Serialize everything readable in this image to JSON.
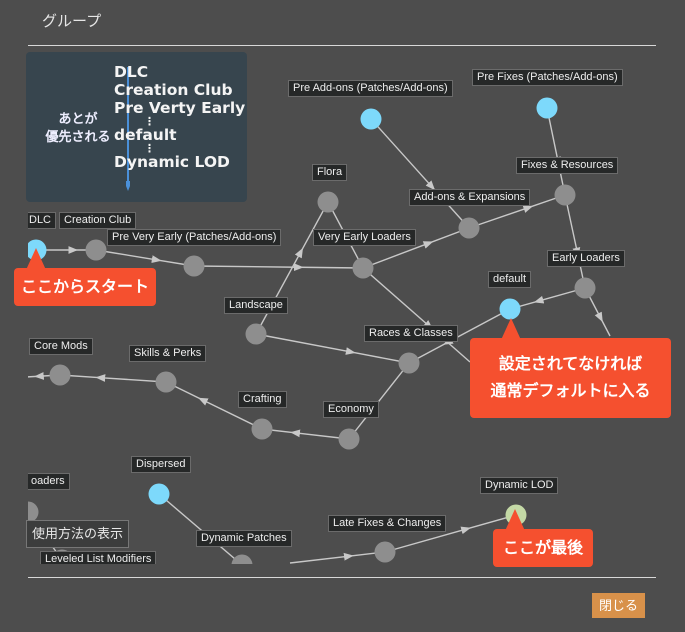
{
  "dialog": {
    "title": "グループ",
    "close_label": "閉じる",
    "usage_label": "使用方法の表示"
  },
  "legend": {
    "side_text": [
      "あとが",
      "優先される"
    ],
    "items": [
      "DLC",
      "Creation Club",
      "Pre Verty Early",
      "⋮",
      "default",
      "⋮",
      "Dynamic LOD"
    ],
    "arrow_color": "#4a90d9"
  },
  "colors": {
    "background": "#4d4d4d",
    "node_default": "#8e8e8e",
    "node_root": "#7dd9fb",
    "node_last": "#c4d9a6",
    "edge": "#c8c8c8",
    "callout": "#f5502f",
    "close_button": "#d8914a"
  },
  "nodes": [
    {
      "id": "dlc",
      "label": "DLC",
      "kind": "root"
    },
    {
      "id": "creation_club",
      "label": "Creation Club",
      "kind": "normal"
    },
    {
      "id": "pre_very_early",
      "label": "Pre Very Early (Patches/Add-ons)",
      "kind": "normal"
    },
    {
      "id": "flora",
      "label": "Flora",
      "kind": "normal"
    },
    {
      "id": "very_early",
      "label": "Very Early Loaders",
      "kind": "normal"
    },
    {
      "id": "landscape",
      "label": "Landscape",
      "kind": "normal"
    },
    {
      "id": "pre_addons",
      "label": "Pre Add-ons (Patches/Add-ons)",
      "kind": "root"
    },
    {
      "id": "addons",
      "label": "Add-ons & Expansions",
      "kind": "normal"
    },
    {
      "id": "pre_fixes",
      "label": "Pre Fixes (Patches/Add-ons)",
      "kind": "root"
    },
    {
      "id": "fixes",
      "label": "Fixes & Resources",
      "kind": "normal"
    },
    {
      "id": "early_loaders",
      "label": "Early Loaders",
      "kind": "normal"
    },
    {
      "id": "default",
      "label": "default",
      "kind": "root"
    },
    {
      "id": "races",
      "label": "Races & Classes",
      "kind": "normal"
    },
    {
      "id": "economy",
      "label": "Economy",
      "kind": "normal"
    },
    {
      "id": "crafting",
      "label": "Crafting",
      "kind": "normal"
    },
    {
      "id": "skills",
      "label": "Skills & Perks",
      "kind": "normal"
    },
    {
      "id": "core_mods",
      "label": "Core Mods",
      "kind": "normal"
    },
    {
      "id": "loaders",
      "label": "oaders",
      "kind": "normal"
    },
    {
      "id": "dispersed",
      "label": "Dispersed",
      "kind": "root"
    },
    {
      "id": "dynamic_patches",
      "label": "Dynamic Patches",
      "kind": "normal"
    },
    {
      "id": "leveled_list",
      "label": "Leveled List Modifiers",
      "kind": "normal"
    },
    {
      "id": "late_fixes",
      "label": "Late Fixes & Changes",
      "kind": "normal"
    },
    {
      "id": "dynamic_lod",
      "label": "Dynamic LOD",
      "kind": "last"
    }
  ],
  "edges": [
    [
      "dlc",
      "creation_club"
    ],
    [
      "creation_club",
      "pre_very_early"
    ],
    [
      "pre_very_early",
      "very_early"
    ],
    [
      "flora",
      "very_early"
    ],
    [
      "landscape",
      "flora"
    ],
    [
      "very_early",
      "addons"
    ],
    [
      "very_early",
      "offscreen_right"
    ],
    [
      "pre_addons",
      "addons"
    ],
    [
      "addons",
      "fixes"
    ],
    [
      "pre_fixes",
      "fixes"
    ],
    [
      "fixes",
      "early_loaders"
    ],
    [
      "early_loaders",
      "default"
    ],
    [
      "early_loaders",
      "offscreen_right2"
    ],
    [
      "default",
      "races"
    ],
    [
      "landscape",
      "races"
    ],
    [
      "races",
      "economy"
    ],
    [
      "economy",
      "crafting"
    ],
    [
      "crafting",
      "skills"
    ],
    [
      "skills",
      "core_mods"
    ],
    [
      "core_mods",
      "offscreen_left"
    ],
    [
      "loaders",
      "leveled_list"
    ],
    [
      "dispersed",
      "dynamic_patches"
    ],
    [
      "dynamic_patches",
      "offscreen_bottom"
    ],
    [
      "offscreen_bottom2",
      "late_fixes"
    ],
    [
      "late_fixes",
      "dynamic_lod"
    ]
  ],
  "callouts": {
    "start": "ここからスタート",
    "default_lines": [
      "設定されてなければ",
      "通常デフォルトに入る"
    ],
    "last": "ここが最後"
  }
}
